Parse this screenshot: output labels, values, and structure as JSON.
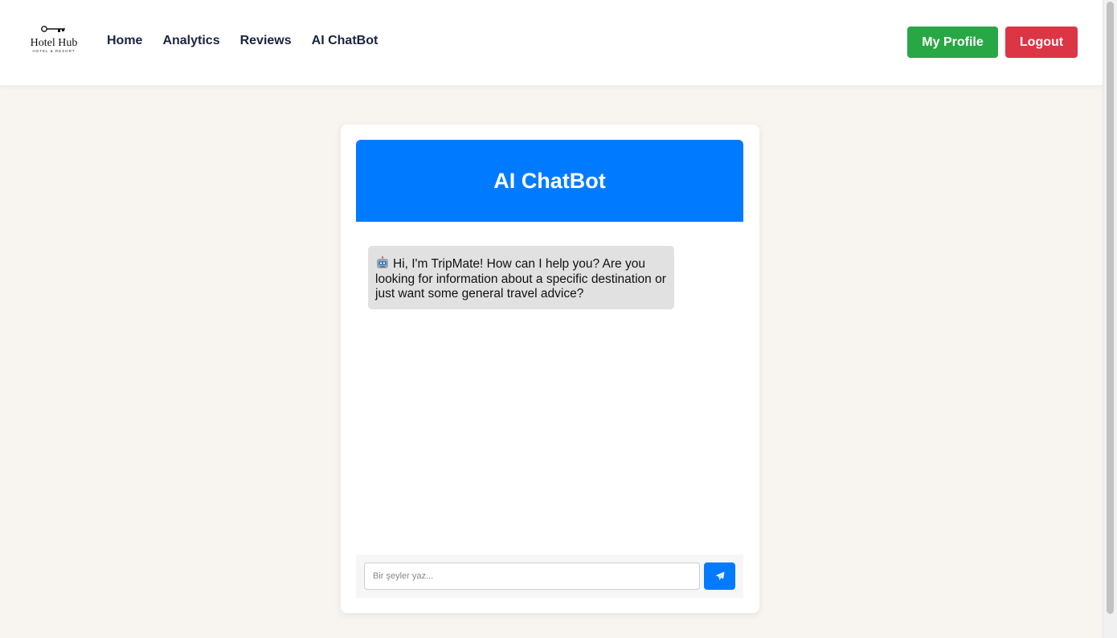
{
  "brand": {
    "name": "Hotel Hub",
    "tagline": "HOTEL & RESORT"
  },
  "nav": {
    "links": [
      {
        "label": "Home"
      },
      {
        "label": "Analytics"
      },
      {
        "label": "Reviews"
      },
      {
        "label": "AI ChatBot"
      }
    ],
    "profile_label": "My Profile",
    "logout_label": "Logout"
  },
  "chat": {
    "title": "AI ChatBot",
    "messages": [
      {
        "sender": "bot",
        "icon": "robot-icon",
        "text": "Hi, I'm TripMate! How can I help you? Are you looking for information about a specific destination or just want some general travel advice?"
      }
    ],
    "input_placeholder": "Bir şeyler yaz...",
    "input_value": "",
    "send_icon": "paper-plane-icon"
  },
  "colors": {
    "accent": "#007bff",
    "profile_button": "#28a745",
    "logout_button": "#dc3545",
    "background": "#f8f5f1",
    "nav_text": "#1b2340"
  }
}
